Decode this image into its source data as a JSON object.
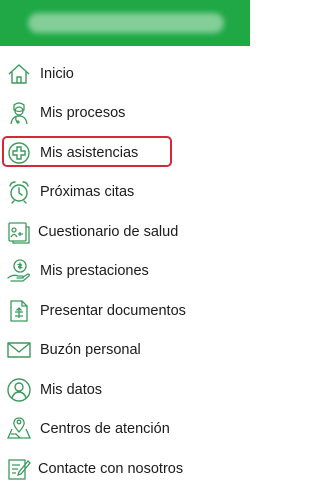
{
  "header": {
    "background": "#1fa845",
    "user_name_blurred": true
  },
  "accent_color": "#1fa845",
  "icon_color": "#3a9a5c",
  "selection_color": "#d6283c",
  "menu": {
    "items": [
      {
        "label": "Inicio",
        "icon": "home-icon"
      },
      {
        "label": "Mis procesos",
        "icon": "doctor-icon"
      },
      {
        "label": "Mis asistencias",
        "icon": "medical-cross-icon",
        "selected": true
      },
      {
        "label": "Próximas citas",
        "icon": "alarm-clock-icon"
      },
      {
        "label": "Cuestionario de salud",
        "icon": "health-form-icon"
      },
      {
        "label": "Mis prestaciones",
        "icon": "hand-coin-icon"
      },
      {
        "label": "Presentar documentos",
        "icon": "document-upload-icon"
      },
      {
        "label": "Buzón personal",
        "icon": "mail-icon"
      },
      {
        "label": "Mis datos",
        "icon": "user-icon"
      },
      {
        "label": "Centros de atención",
        "icon": "map-location-icon"
      },
      {
        "label": "Contacte con nosotros",
        "icon": "contact-form-icon"
      }
    ]
  }
}
